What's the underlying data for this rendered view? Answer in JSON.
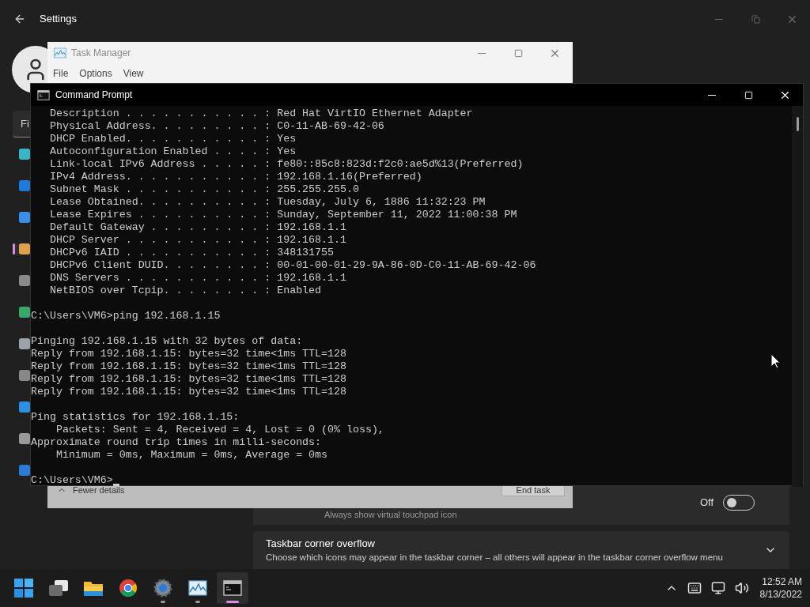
{
  "settings": {
    "title": "Settings",
    "search_text": "Fi",
    "nav": [
      {
        "color": "#3bb4c8",
        "selected": false
      },
      {
        "color": "#1f7ad8",
        "selected": false
      },
      {
        "color": "#3a8ee6",
        "selected": false
      },
      {
        "color": "#e0a050",
        "selected": true
      },
      {
        "color": "#8a8a8a",
        "selected": false
      },
      {
        "color": "#3aa66a",
        "selected": false
      },
      {
        "color": "#9aa4aa",
        "selected": false
      },
      {
        "color": "#888888",
        "selected": false
      },
      {
        "color": "#2f8fe0",
        "selected": false
      },
      {
        "color": "#9a9a9a",
        "selected": false
      },
      {
        "color": "#2b7bd6",
        "selected": false
      }
    ],
    "touchpad_card": {
      "description": "Always show virtual touchpad icon",
      "toggle_label": "Off",
      "on": false
    },
    "overflow_card": {
      "title": "Taskbar corner overflow",
      "description": "Choose which icons may appear in the taskbar corner – all others will appear in the taskbar corner overflow menu",
      "expanded": false
    }
  },
  "task_manager": {
    "title": "Task Manager",
    "menu": [
      "File",
      "Options",
      "View"
    ],
    "details_label": "Fewer details",
    "end_task": "End task"
  },
  "command_prompt": {
    "title": "Command Prompt",
    "blocks": [
      [
        "   Description . . . . . . . . . . . : Red Hat VirtIO Ethernet Adapter",
        "   Physical Address. . . . . . . . . : C0-11-AB-69-42-06",
        "   DHCP Enabled. . . . . . . . . . . : Yes",
        "   Autoconfiguration Enabled . . . . : Yes",
        "   Link-local IPv6 Address . . . . . : fe80::85c8:823d:f2c0:ae5d%13(Preferred)",
        "   IPv4 Address. . . . . . . . . . . : 192.168.1.16(Preferred)",
        "   Subnet Mask . . . . . . . . . . . : 255.255.255.0",
        "   Lease Obtained. . . . . . . . . . : Tuesday, July 6, 1886 11:32:23 PM",
        "   Lease Expires . . . . . . . . . . : Sunday, September 11, 2022 11:00:38 PM",
        "   Default Gateway . . . . . . . . . : 192.168.1.1",
        "   DHCP Server . . . . . . . . . . . : 192.168.1.1",
        "   DHCPv6 IAID . . . . . . . . . . . : 348131755",
        "   DHCPv6 Client DUID. . . . . . . . : 00-01-00-01-29-9A-86-0D-C0-11-AB-69-42-06",
        "   DNS Servers . . . . . . . . . . . : 192.168.1.1",
        "   NetBIOS over Tcpip. . . . . . . . : Enabled"
      ],
      [
        "C:\\Users\\VM6>ping 192.168.1.15"
      ],
      [
        "Pinging 192.168.1.15 with 32 bytes of data:",
        "Reply from 192.168.1.15: bytes=32 time<1ms TTL=128",
        "Reply from 192.168.1.15: bytes=32 time<1ms TTL=128",
        "Reply from 192.168.1.15: bytes=32 time<1ms TTL=128",
        "Reply from 192.168.1.15: bytes=32 time<1ms TTL=128"
      ],
      [
        "Ping statistics for 192.168.1.15:",
        "    Packets: Sent = 4, Received = 4, Lost = 0 (0% loss),",
        "Approximate round trip times in milli-seconds:",
        "    Minimum = 0ms, Maximum = 0ms, Average = 0ms"
      ],
      [
        "C:\\Users\\VM6>"
      ]
    ]
  },
  "taskbar": {
    "apps": [
      {
        "kind": "start",
        "running": false,
        "selected": false
      },
      {
        "kind": "task-view",
        "running": false,
        "selected": false
      },
      {
        "kind": "explorer",
        "running": false,
        "selected": false
      },
      {
        "kind": "browser",
        "running": false,
        "selected": false
      },
      {
        "kind": "settings",
        "running": true,
        "selected": false
      },
      {
        "kind": "task-manager",
        "running": true,
        "selected": false
      },
      {
        "kind": "terminal",
        "running": true,
        "selected": true
      }
    ],
    "time": "12:52 AM",
    "date": "8/13/2022"
  }
}
